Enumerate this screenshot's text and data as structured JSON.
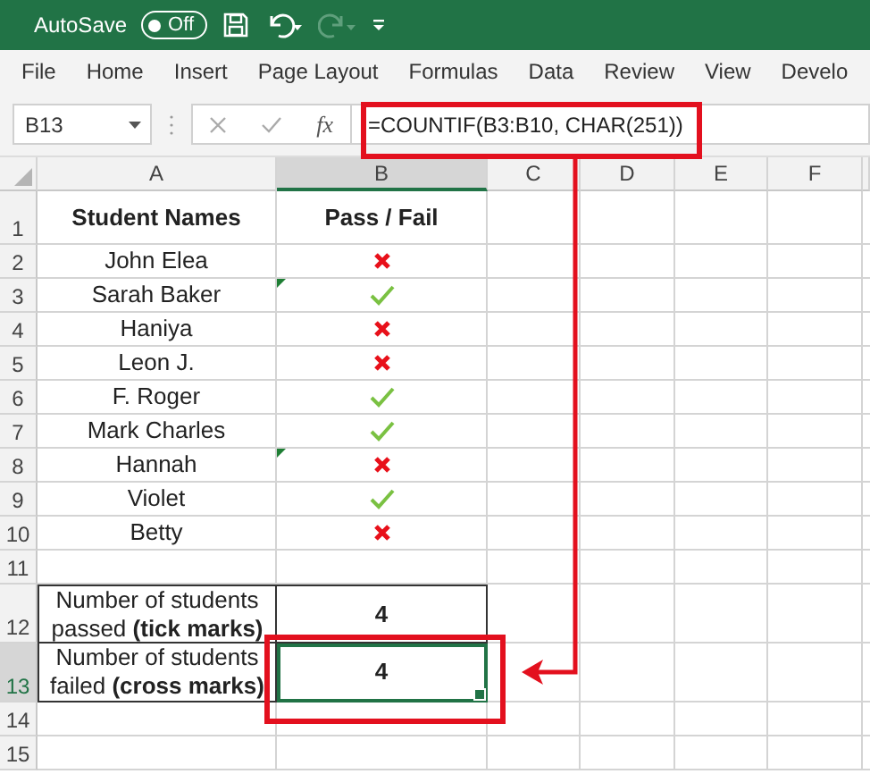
{
  "title_bar": {
    "autosave_label": "AutoSave",
    "autosave_toggle": "Off",
    "autosave_on": false,
    "undo_disabled": false,
    "redo_disabled": true
  },
  "ribbon_tabs": [
    "File",
    "Home",
    "Insert",
    "Page Layout",
    "Formulas",
    "Data",
    "Review",
    "View",
    "Develo"
  ],
  "formula_bar": {
    "name_box": "B13",
    "function_button": "fx",
    "formula": "=COUNTIF(B3:B10, CHAR(251))"
  },
  "columns": [
    {
      "label": "A",
      "selected": false
    },
    {
      "label": "B",
      "selected": true
    },
    {
      "label": "C",
      "selected": false
    },
    {
      "label": "D",
      "selected": false
    },
    {
      "label": "E",
      "selected": false
    },
    {
      "label": "F",
      "selected": false
    }
  ],
  "rows": [
    {
      "number": "1",
      "selected": false,
      "kind": "header",
      "a": "Student Names",
      "b": "Pass / Fail"
    },
    {
      "number": "2",
      "selected": false,
      "kind": "student",
      "a": "John Elea",
      "passed": false,
      "flagged": false
    },
    {
      "number": "3",
      "selected": false,
      "kind": "student",
      "a": "Sarah Baker",
      "passed": true,
      "flagged": true
    },
    {
      "number": "4",
      "selected": false,
      "kind": "student",
      "a": "Haniya",
      "passed": false,
      "flagged": false
    },
    {
      "number": "5",
      "selected": false,
      "kind": "student",
      "a": "Leon J.",
      "passed": false,
      "flagged": false
    },
    {
      "number": "6",
      "selected": false,
      "kind": "student",
      "a": "F. Roger",
      "passed": true,
      "flagged": false
    },
    {
      "number": "7",
      "selected": false,
      "kind": "student",
      "a": "Mark Charles",
      "passed": true,
      "flagged": false
    },
    {
      "number": "8",
      "selected": false,
      "kind": "student",
      "a": "Hannah",
      "passed": false,
      "flagged": true
    },
    {
      "number": "9",
      "selected": false,
      "kind": "student",
      "a": "Violet",
      "passed": true,
      "flagged": false
    },
    {
      "number": "10",
      "selected": false,
      "kind": "student",
      "a": "Betty",
      "passed": false,
      "flagged": false
    },
    {
      "number": "11",
      "selected": false,
      "kind": "blank"
    },
    {
      "number": "12",
      "selected": false,
      "kind": "summary",
      "a": "Number of students passed **(tick marks)**",
      "b": "4",
      "active": false
    },
    {
      "number": "13",
      "selected": true,
      "kind": "summary",
      "a": "Number of students failed **(cross marks)**",
      "b": "4",
      "active": true
    },
    {
      "number": "14",
      "selected": false,
      "kind": "blank"
    },
    {
      "number": "15",
      "selected": false,
      "kind": "blank"
    }
  ]
}
